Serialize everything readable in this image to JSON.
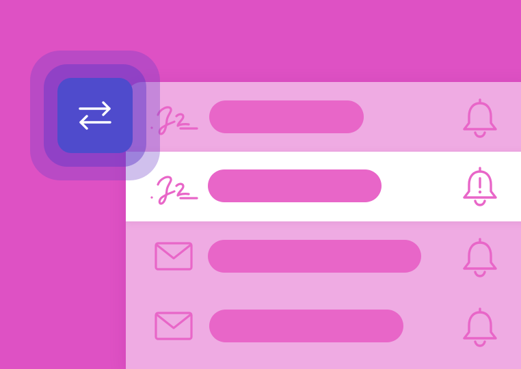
{
  "colors": {
    "background": "#de51c4",
    "accent": "#4f4bcc",
    "icon_pink": "#e866c8",
    "row_active": "#ffffff"
  },
  "switch_button": {
    "icon": "swap-arrows-icon"
  },
  "rows": [
    {
      "icon": "signature-icon",
      "alert_icon": "bell-icon",
      "active": false
    },
    {
      "icon": "signature-icon",
      "alert_icon": "bell-alert-icon",
      "active": true
    },
    {
      "icon": "mail-icon",
      "alert_icon": "bell-icon",
      "active": false
    },
    {
      "icon": "mail-icon",
      "alert_icon": "bell-icon",
      "active": false
    }
  ]
}
